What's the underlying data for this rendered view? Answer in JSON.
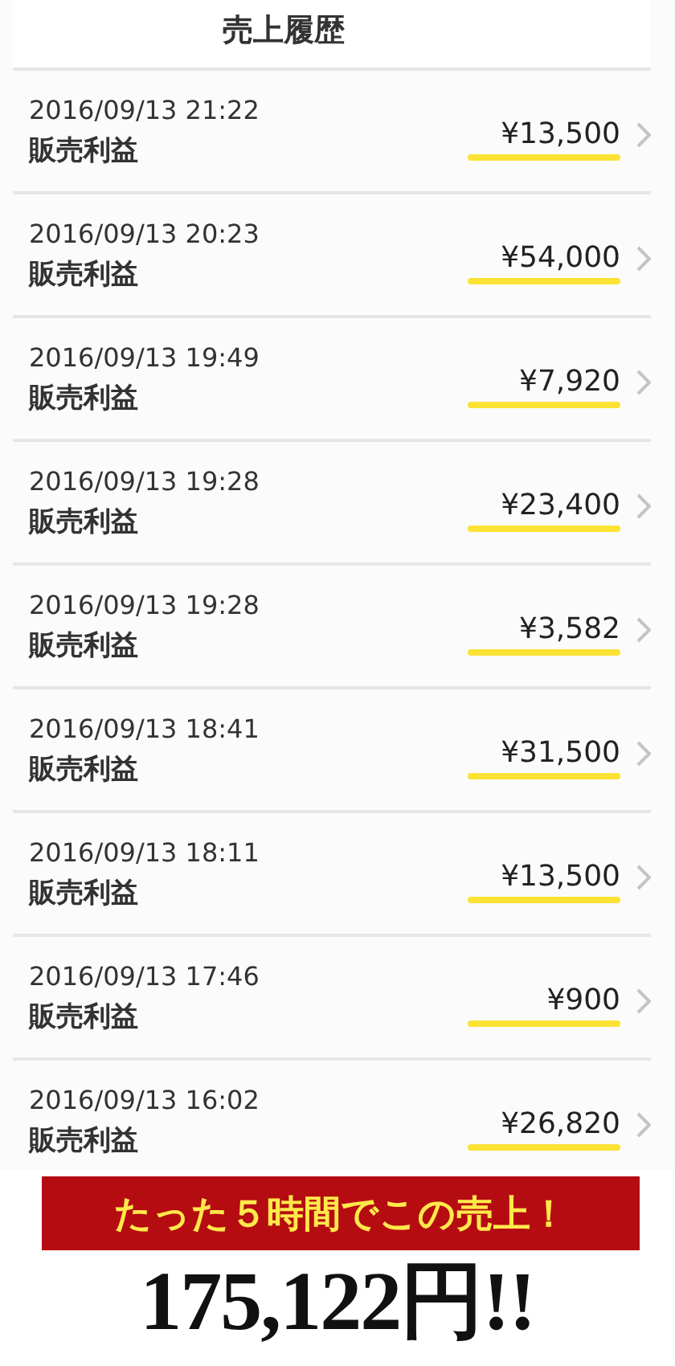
{
  "header": {
    "title": "売上履歴"
  },
  "rows": [
    {
      "datetime": "2016/09/13 21:22",
      "label": "販売利益",
      "amount": "¥13,500"
    },
    {
      "datetime": "2016/09/13 20:23",
      "label": "販売利益",
      "amount": "¥54,000"
    },
    {
      "datetime": "2016/09/13 19:49",
      "label": "販売利益",
      "amount": "¥7,920"
    },
    {
      "datetime": "2016/09/13 19:28",
      "label": "販売利益",
      "amount": "¥23,400"
    },
    {
      "datetime": "2016/09/13 19:28",
      "label": "販売利益",
      "amount": "¥3,582"
    },
    {
      "datetime": "2016/09/13 18:41",
      "label": "販売利益",
      "amount": "¥31,500"
    },
    {
      "datetime": "2016/09/13 18:11",
      "label": "販売利益",
      "amount": "¥13,500"
    },
    {
      "datetime": "2016/09/13 17:46",
      "label": "販売利益",
      "amount": "¥900"
    },
    {
      "datetime": "2016/09/13 16:02",
      "label": "販売利益",
      "amount": "¥26,820"
    }
  ],
  "banner": {
    "text": "たった５時間でこの売上！"
  },
  "total": "175,122円!!"
}
